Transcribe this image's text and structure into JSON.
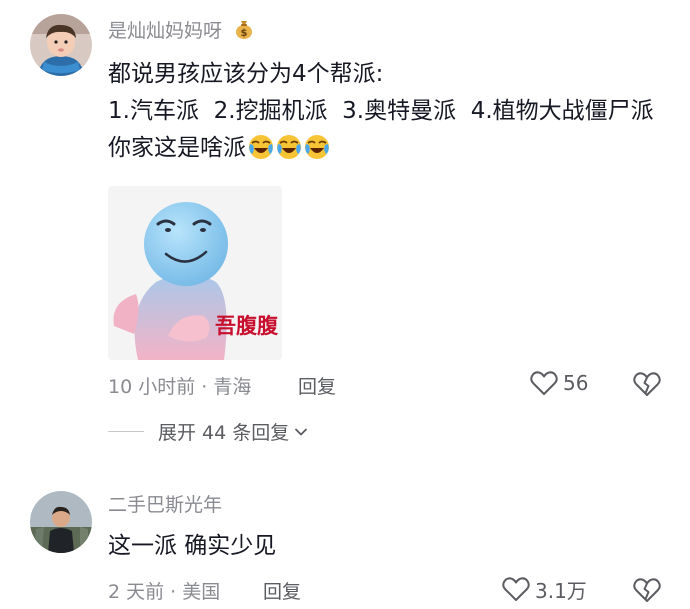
{
  "comments": [
    {
      "username": "是灿灿妈妈呀",
      "badge_icon": "money-bag-emoji",
      "text": "都说男孩应该分为4个帮派:\n1.汽车派  2.挖掘机派  3.奥特曼派  4.植物大战僵尸派 你家这是啥派",
      "emojis": [
        "laughing-crying-emoji",
        "laughing-crying-emoji",
        "laughing-crying-emoji"
      ],
      "sticker_caption": "吾腹腹",
      "time": "10 小时前",
      "location": "青海",
      "meta_separator": " · ",
      "reply_label": "回复",
      "like_count": "56",
      "expand_label": "展开 44 条回复"
    },
    {
      "username": "二手巴斯光年",
      "text": "这一派 确实少见",
      "time": "2 天前",
      "location": "美国",
      "meta_separator": " · ",
      "reply_label": "回复",
      "like_count": "3.1万"
    }
  ],
  "colors": {
    "primary_text": "#161823",
    "secondary_text": "#8a8b91",
    "action_text": "#5b5c61",
    "sticker_caption": "#c8102e"
  }
}
